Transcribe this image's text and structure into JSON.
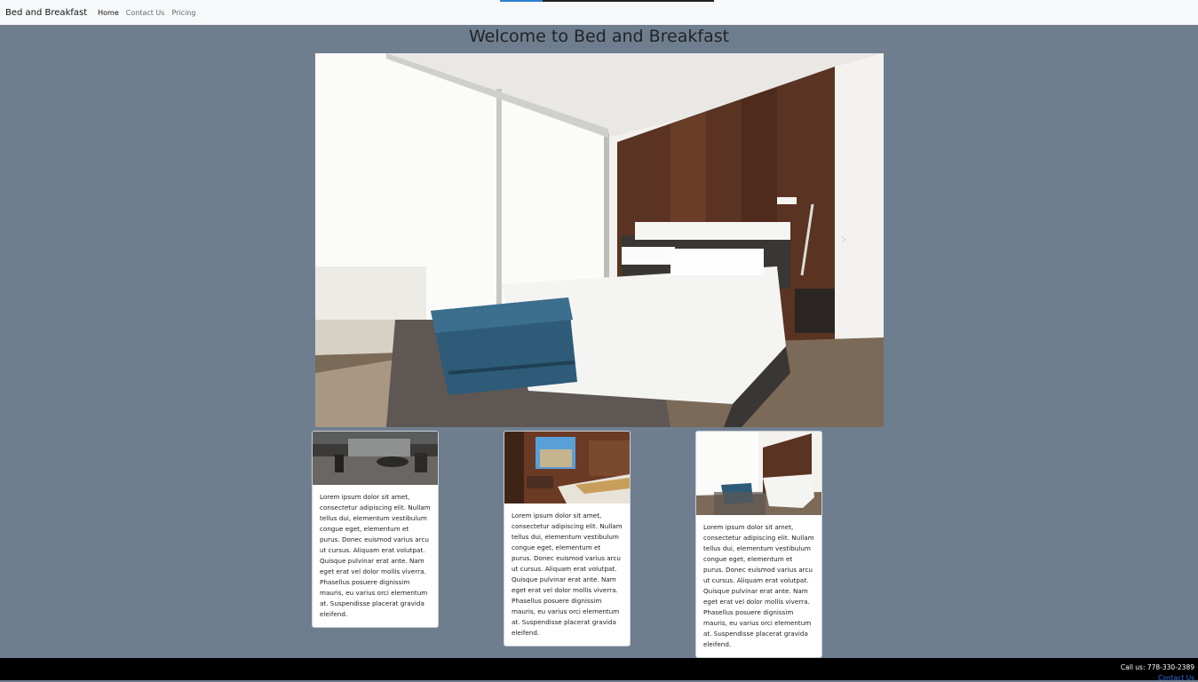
{
  "nav": {
    "brand": "Bed and Breakfast",
    "links": [
      "Home",
      "Contact Us",
      "Pricing"
    ]
  },
  "page": {
    "title": "Welcome to Bed and Breakfast"
  },
  "carousel": {
    "next_icon": "chevron-right-icon",
    "next_glyph": "›"
  },
  "cards": [
    {
      "text": "Lorem ipsum dolor sit amet, consectetur adipiscing elit. Nullam tellus dui, elementum vestibulum congue eget, elementum et purus. Donec euismod varius arcu ut cursus. Aliquam erat volutpat. Quisque pulvinar erat ante. Nam eget erat vel dolor mollis viverra. Phasellus posuere dignissim mauris, eu varius orci elementum at. Suspendisse placerat gravida eleifend."
    },
    {
      "text": "Lorem ipsum dolor sit amet, consectetur adipiscing elit. Nullam tellus dui, elementum vestibulum congue eget, elementum et purus. Donec euismod varius arcu ut cursus. Aliquam erat volutpat. Quisque pulvinar erat ante. Nam eget erat vel dolor mollis viverra. Phasellus posuere dignissim mauris, eu varius orci elementum at. Suspendisse placerat gravida eleifend."
    },
    {
      "text": "Lorem ipsum dolor sit amet, consectetur adipiscing elit. Nullam tellus dui, elementum vestibulum congue eget, elementum et purus. Donec euismod varius arcu ut cursus. Aliquam erat volutpat. Quisque pulvinar erat ante. Nam eget erat vel dolor mollis viverra. Phasellus posuere dignissim mauris, eu varius orci elementum at. Suspendisse placerat gravida eleifend."
    }
  ],
  "footer": {
    "call": "Call us: 778-330-2389",
    "contact": "Contact Us"
  },
  "colors": {
    "page_bg": "#6f7e8f",
    "navbar_bg": "#f7f8f9",
    "footer_bg": "#000000",
    "link_blue": "#2f6fe0"
  }
}
